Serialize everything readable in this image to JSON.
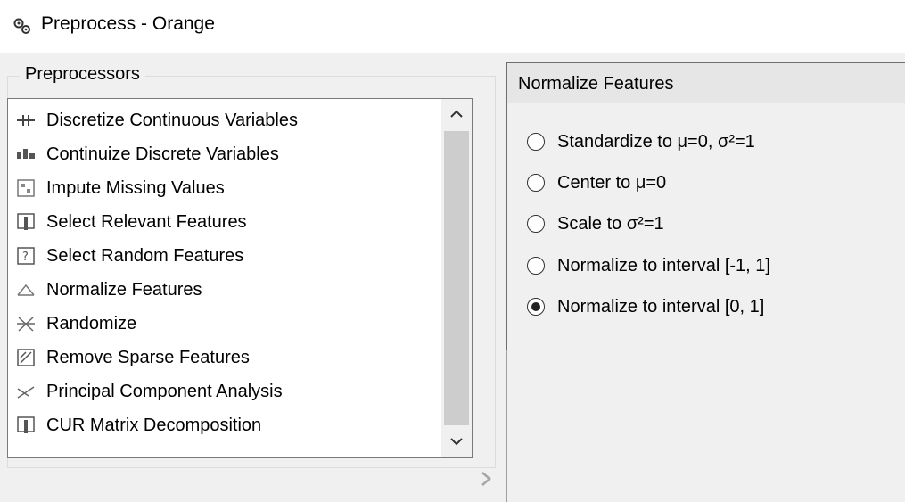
{
  "window": {
    "title": "Preprocess - Orange",
    "icon": "orange-preprocess-icon"
  },
  "preprocessors": {
    "group_title": "Preprocessors",
    "items": [
      {
        "label": "Discretize Continuous Variables",
        "icon": "discretize-icon"
      },
      {
        "label": "Continuize Discrete Variables",
        "icon": "continuize-icon"
      },
      {
        "label": "Impute Missing Values",
        "icon": "impute-icon"
      },
      {
        "label": "Select Relevant Features",
        "icon": "select-relevant-icon"
      },
      {
        "label": "Select Random Features",
        "icon": "select-random-icon"
      },
      {
        "label": "Normalize Features",
        "icon": "normalize-icon"
      },
      {
        "label": "Randomize",
        "icon": "randomize-icon"
      },
      {
        "label": "Remove Sparse Features",
        "icon": "remove-sparse-icon"
      },
      {
        "label": "Principal Component Analysis",
        "icon": "pca-icon"
      },
      {
        "label": "CUR Matrix Decomposition",
        "icon": "cur-icon"
      }
    ]
  },
  "normalize_panel": {
    "title": "Normalize Features",
    "options": [
      {
        "label": "Standardize to μ=0, σ²=1",
        "selected": false
      },
      {
        "label": "Center to μ=0",
        "selected": false
      },
      {
        "label": "Scale to σ²=1",
        "selected": false
      },
      {
        "label": "Normalize to interval [-1, 1]",
        "selected": false
      },
      {
        "label": "Normalize to interval [0, 1]",
        "selected": true
      }
    ]
  },
  "colors": {
    "background": "#f0f0f0",
    "list_background": "#ffffff",
    "panel_header": "#e6e6e6"
  }
}
